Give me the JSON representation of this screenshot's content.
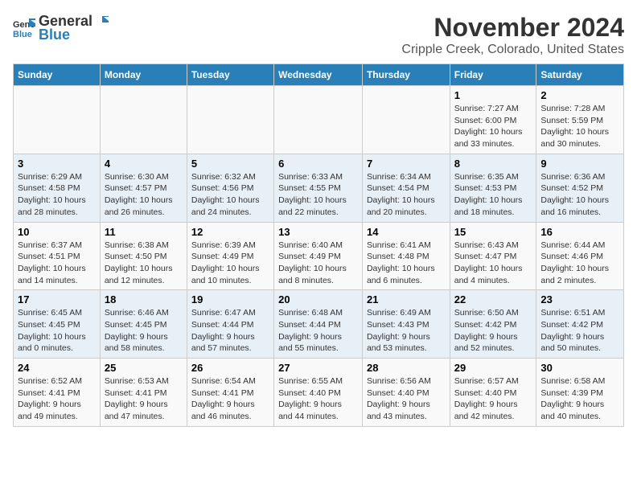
{
  "header": {
    "logo_general": "General",
    "logo_blue": "Blue",
    "month": "November 2024",
    "location": "Cripple Creek, Colorado, United States"
  },
  "weekdays": [
    "Sunday",
    "Monday",
    "Tuesday",
    "Wednesday",
    "Thursday",
    "Friday",
    "Saturday"
  ],
  "weeks": [
    [
      {
        "day": "",
        "info": ""
      },
      {
        "day": "",
        "info": ""
      },
      {
        "day": "",
        "info": ""
      },
      {
        "day": "",
        "info": ""
      },
      {
        "day": "",
        "info": ""
      },
      {
        "day": "1",
        "info": "Sunrise: 7:27 AM\nSunset: 6:00 PM\nDaylight: 10 hours and 33 minutes."
      },
      {
        "day": "2",
        "info": "Sunrise: 7:28 AM\nSunset: 5:59 PM\nDaylight: 10 hours and 30 minutes."
      }
    ],
    [
      {
        "day": "3",
        "info": "Sunrise: 6:29 AM\nSunset: 4:58 PM\nDaylight: 10 hours and 28 minutes."
      },
      {
        "day": "4",
        "info": "Sunrise: 6:30 AM\nSunset: 4:57 PM\nDaylight: 10 hours and 26 minutes."
      },
      {
        "day": "5",
        "info": "Sunrise: 6:32 AM\nSunset: 4:56 PM\nDaylight: 10 hours and 24 minutes."
      },
      {
        "day": "6",
        "info": "Sunrise: 6:33 AM\nSunset: 4:55 PM\nDaylight: 10 hours and 22 minutes."
      },
      {
        "day": "7",
        "info": "Sunrise: 6:34 AM\nSunset: 4:54 PM\nDaylight: 10 hours and 20 minutes."
      },
      {
        "day": "8",
        "info": "Sunrise: 6:35 AM\nSunset: 4:53 PM\nDaylight: 10 hours and 18 minutes."
      },
      {
        "day": "9",
        "info": "Sunrise: 6:36 AM\nSunset: 4:52 PM\nDaylight: 10 hours and 16 minutes."
      }
    ],
    [
      {
        "day": "10",
        "info": "Sunrise: 6:37 AM\nSunset: 4:51 PM\nDaylight: 10 hours and 14 minutes."
      },
      {
        "day": "11",
        "info": "Sunrise: 6:38 AM\nSunset: 4:50 PM\nDaylight: 10 hours and 12 minutes."
      },
      {
        "day": "12",
        "info": "Sunrise: 6:39 AM\nSunset: 4:49 PM\nDaylight: 10 hours and 10 minutes."
      },
      {
        "day": "13",
        "info": "Sunrise: 6:40 AM\nSunset: 4:49 PM\nDaylight: 10 hours and 8 minutes."
      },
      {
        "day": "14",
        "info": "Sunrise: 6:41 AM\nSunset: 4:48 PM\nDaylight: 10 hours and 6 minutes."
      },
      {
        "day": "15",
        "info": "Sunrise: 6:43 AM\nSunset: 4:47 PM\nDaylight: 10 hours and 4 minutes."
      },
      {
        "day": "16",
        "info": "Sunrise: 6:44 AM\nSunset: 4:46 PM\nDaylight: 10 hours and 2 minutes."
      }
    ],
    [
      {
        "day": "17",
        "info": "Sunrise: 6:45 AM\nSunset: 4:45 PM\nDaylight: 10 hours and 0 minutes."
      },
      {
        "day": "18",
        "info": "Sunrise: 6:46 AM\nSunset: 4:45 PM\nDaylight: 9 hours and 58 minutes."
      },
      {
        "day": "19",
        "info": "Sunrise: 6:47 AM\nSunset: 4:44 PM\nDaylight: 9 hours and 57 minutes."
      },
      {
        "day": "20",
        "info": "Sunrise: 6:48 AM\nSunset: 4:44 PM\nDaylight: 9 hours and 55 minutes."
      },
      {
        "day": "21",
        "info": "Sunrise: 6:49 AM\nSunset: 4:43 PM\nDaylight: 9 hours and 53 minutes."
      },
      {
        "day": "22",
        "info": "Sunrise: 6:50 AM\nSunset: 4:42 PM\nDaylight: 9 hours and 52 minutes."
      },
      {
        "day": "23",
        "info": "Sunrise: 6:51 AM\nSunset: 4:42 PM\nDaylight: 9 hours and 50 minutes."
      }
    ],
    [
      {
        "day": "24",
        "info": "Sunrise: 6:52 AM\nSunset: 4:41 PM\nDaylight: 9 hours and 49 minutes."
      },
      {
        "day": "25",
        "info": "Sunrise: 6:53 AM\nSunset: 4:41 PM\nDaylight: 9 hours and 47 minutes."
      },
      {
        "day": "26",
        "info": "Sunrise: 6:54 AM\nSunset: 4:41 PM\nDaylight: 9 hours and 46 minutes."
      },
      {
        "day": "27",
        "info": "Sunrise: 6:55 AM\nSunset: 4:40 PM\nDaylight: 9 hours and 44 minutes."
      },
      {
        "day": "28",
        "info": "Sunrise: 6:56 AM\nSunset: 4:40 PM\nDaylight: 9 hours and 43 minutes."
      },
      {
        "day": "29",
        "info": "Sunrise: 6:57 AM\nSunset: 4:40 PM\nDaylight: 9 hours and 42 minutes."
      },
      {
        "day": "30",
        "info": "Sunrise: 6:58 AM\nSunset: 4:39 PM\nDaylight: 9 hours and 40 minutes."
      }
    ]
  ]
}
